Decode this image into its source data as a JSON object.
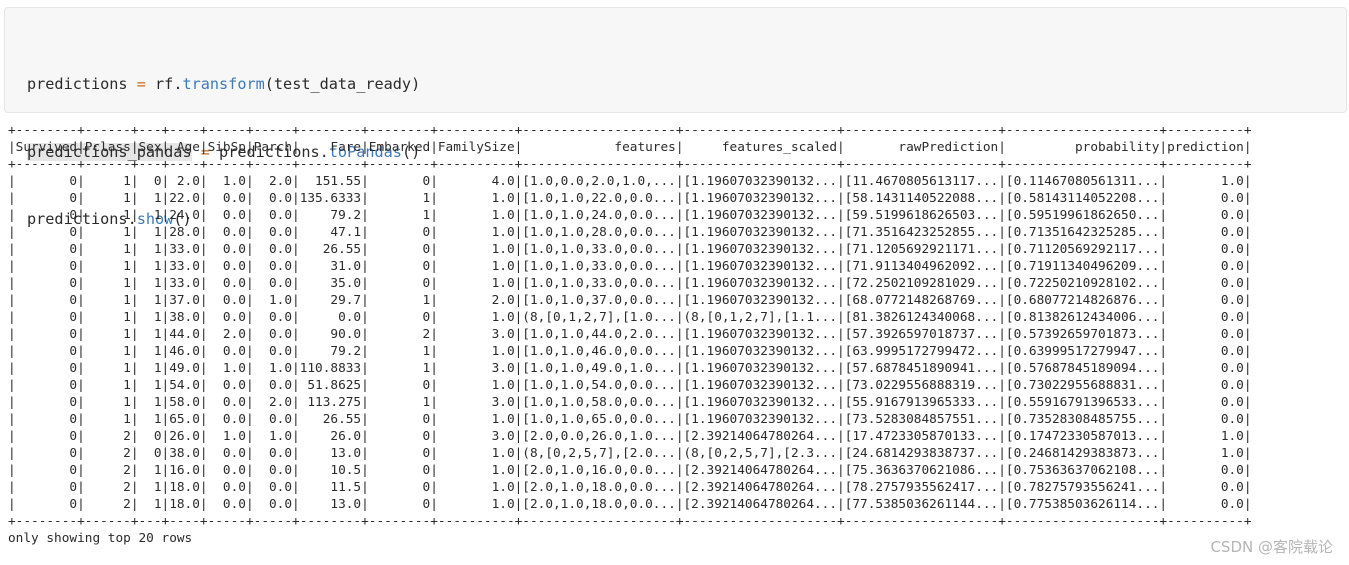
{
  "code_cell": {
    "lines": [
      [
        {
          "text": "predictions ",
          "cls": ""
        },
        {
          "text": "=",
          "cls": "op"
        },
        {
          "text": " rf.",
          "cls": ""
        },
        {
          "text": "transform",
          "cls": "fn"
        },
        {
          "text": "(test_data_ready)",
          "cls": ""
        }
      ],
      [
        {
          "text": "predictions_pandas",
          "cls": "hl"
        },
        {
          "text": " ",
          "cls": ""
        },
        {
          "text": "=",
          "cls": "op"
        },
        {
          "text": " predictions.",
          "cls": ""
        },
        {
          "text": "toPandas",
          "cls": "fn"
        },
        {
          "text": "()",
          "cls": ""
        }
      ],
      [
        {
          "text": "predictions.",
          "cls": ""
        },
        {
          "text": "show",
          "cls": "fn"
        },
        {
          "text": "()",
          "cls": ""
        }
      ]
    ]
  },
  "output": {
    "table": {
      "separator": "+--------+------+---+----+-----+-----+--------+--------+----------+--------------------+--------------------+--------------------+--------------------+----------+",
      "header": "|Survived|Pclass|Sex| Age|SibSp|Parch|    Fare|Embarked|FamilySize|            features|     features_scaled|       rawPrediction|         probability|prediction|",
      "rows": [
        "|       0|     1|  0| 2.0|  1.0|  2.0|  151.55|       0|       4.0|[1.0,0.0,2.0,1.0,...|[1.19607032390132...|[11.4670805613117...|[0.11467080561311...|       1.0|",
        "|       0|     1|  1|22.0|  0.0|  0.0|135.6333|       1|       1.0|[1.0,1.0,22.0,0.0...|[1.19607032390132...|[58.1431140522088...|[0.58143114052208...|       0.0|",
        "|       0|     1|  1|24.0|  0.0|  0.0|    79.2|       1|       1.0|[1.0,1.0,24.0,0.0...|[1.19607032390132...|[59.5199618626503...|[0.59519961862650...|       0.0|",
        "|       0|     1|  1|28.0|  0.0|  0.0|    47.1|       0|       1.0|[1.0,1.0,28.0,0.0...|[1.19607032390132...|[71.3516423252855...|[0.71351642325285...|       0.0|",
        "|       0|     1|  1|33.0|  0.0|  0.0|   26.55|       0|       1.0|[1.0,1.0,33.0,0.0...|[1.19607032390132...|[71.1205692921171...|[0.71120569292117...|       0.0|",
        "|       0|     1|  1|33.0|  0.0|  0.0|    31.0|       0|       1.0|[1.0,1.0,33.0,0.0...|[1.19607032390132...|[71.9113404962092...|[0.71911340496209...|       0.0|",
        "|       0|     1|  1|33.0|  0.0|  0.0|    35.0|       0|       1.0|[1.0,1.0,33.0,0.0...|[1.19607032390132...|[72.2502109281029...|[0.72250210928102...|       0.0|",
        "|       0|     1|  1|37.0|  0.0|  1.0|    29.7|       1|       2.0|[1.0,1.0,37.0,0.0...|[1.19607032390132...|[68.0772148268769...|[0.68077214826876...|       0.0|",
        "|       0|     1|  1|38.0|  0.0|  0.0|     0.0|       0|       1.0|(8,[0,1,2,7],[1.0...|(8,[0,1,2,7],[1.1...|[81.3826124340068...|[0.81382612434006...|       0.0|",
        "|       0|     1|  1|44.0|  2.0|  0.0|    90.0|       2|       3.0|[1.0,1.0,44.0,2.0...|[1.19607032390132...|[57.3926597018737...|[0.57392659701873...|       0.0|",
        "|       0|     1|  1|46.0|  0.0|  0.0|    79.2|       1|       1.0|[1.0,1.0,46.0,0.0...|[1.19607032390132...|[63.9995172799472...|[0.63999517279947...|       0.0|",
        "|       0|     1|  1|49.0|  1.0|  1.0|110.8833|       1|       3.0|[1.0,1.0,49.0,1.0...|[1.19607032390132...|[57.6878451890941...|[0.57687845189094...|       0.0|",
        "|       0|     1|  1|54.0|  0.0|  0.0| 51.8625|       0|       1.0|[1.0,1.0,54.0,0.0...|[1.19607032390132...|[73.0229556888319...|[0.73022955688831...|       0.0|",
        "|       0|     1|  1|58.0|  0.0|  2.0| 113.275|       1|       3.0|[1.0,1.0,58.0,0.0...|[1.19607032390132...|[55.9167913965333...|[0.55916791396533...|       0.0|",
        "|       0|     1|  1|65.0|  0.0|  0.0|   26.55|       0|       1.0|[1.0,1.0,65.0,0.0...|[1.19607032390132...|[73.5283084857551...|[0.73528308485755...|       0.0|",
        "|       0|     2|  0|26.0|  1.0|  1.0|    26.0|       0|       3.0|[2.0,0.0,26.0,1.0...|[2.39214064780264...|[17.4723305870133...|[0.17472330587013...|       1.0|",
        "|       0|     2|  0|38.0|  0.0|  0.0|    13.0|       0|       1.0|(8,[0,2,5,7],[2.0...|(8,[0,2,5,7],[2.3...|[24.6814293838737...|[0.24681429383873...|       1.0|",
        "|       0|     2|  1|16.0|  0.0|  0.0|    10.5|       0|       1.0|[2.0,1.0,16.0,0.0...|[2.39214064780264...|[75.3636370621086...|[0.75363637062108...|       0.0|",
        "|       0|     2|  1|18.0|  0.0|  0.0|    11.5|       0|       1.0|[2.0,1.0,18.0,0.0...|[2.39214064780264...|[78.2757935562417...|[0.78275793556241...|       0.0|",
        "|       0|     2|  1|18.0|  0.0|  0.0|    13.0|       0|       1.0|[2.0,1.0,18.0,0.0...|[2.39214064780264...|[77.5385036261144...|[0.77538503626114...|       0.0|"
      ]
    },
    "footer_note": "only showing top 20 rows"
  },
  "watermark": "CSDN @客院载论"
}
